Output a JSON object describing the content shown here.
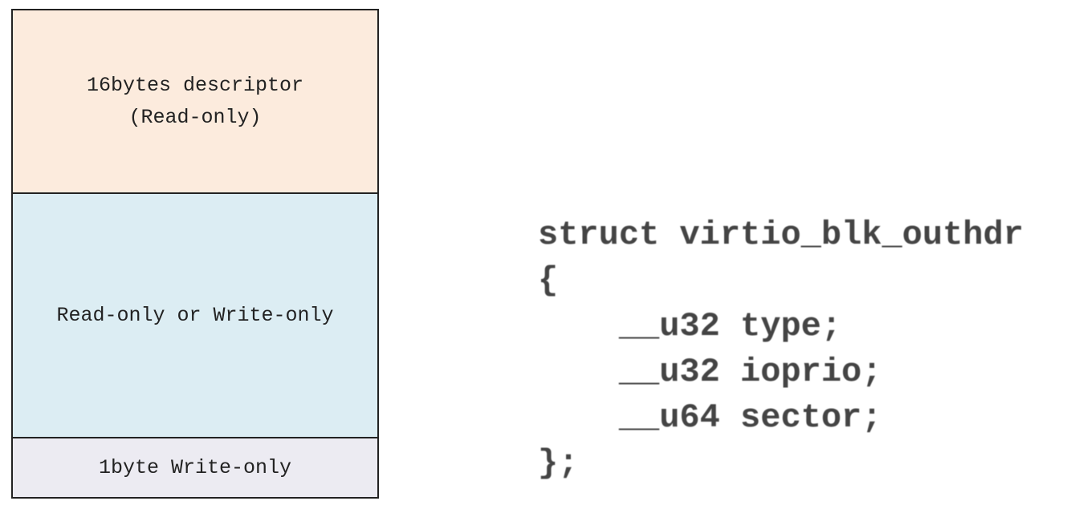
{
  "layout_diagram": {
    "segments": [
      {
        "line1": "16bytes descriptor",
        "line2": "(Read-only)",
        "color": "#fcebdd"
      },
      {
        "line1": "Read-only or Write-only",
        "color": "#dcedf3"
      },
      {
        "line1": "1byte Write-only",
        "color": "#ecebf2"
      }
    ]
  },
  "code": {
    "lines": [
      "struct virtio_blk_outhdr",
      "{",
      "    __u32 type;",
      "    __u32 ioprio;",
      "    __u64 sector;",
      "};"
    ]
  }
}
